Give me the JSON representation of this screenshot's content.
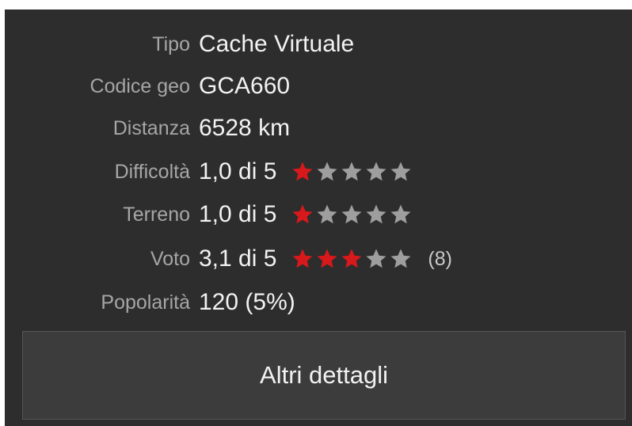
{
  "details": {
    "type": {
      "label": "Tipo",
      "value": "Cache Virtuale"
    },
    "code": {
      "label": "Codice geo",
      "value": "GCA660"
    },
    "distance": {
      "label": "Distanza",
      "value": "6528 km"
    },
    "difficulty": {
      "label": "Difficoltà",
      "value": "1,0 di 5",
      "rating": 1.0,
      "max": 5
    },
    "terrain": {
      "label": "Terreno",
      "value": "1,0 di 5",
      "rating": 1.0,
      "max": 5
    },
    "vote": {
      "label": "Voto",
      "value": "3,1 di 5",
      "rating": 3.1,
      "max": 5,
      "count": "(8)"
    },
    "popularity": {
      "label": "Popolarità",
      "value": "120 (5%)"
    }
  },
  "more_details_button": {
    "label": "Altri dettagli"
  },
  "colors": {
    "star_filled": "#d7191c",
    "star_empty": "#9e9e9e"
  },
  "icons": {
    "star": "star-icon"
  }
}
